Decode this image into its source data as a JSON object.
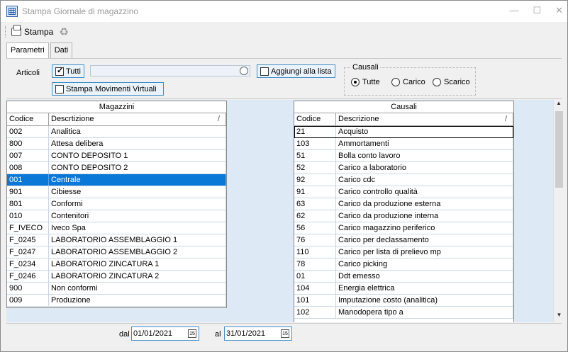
{
  "window": {
    "title": "Stampa Giornale di magazzino",
    "controls": [
      "—",
      "☐",
      "✕"
    ]
  },
  "toolbar": {
    "print_label": "Stampa"
  },
  "tabs": [
    {
      "label": "Parametri"
    },
    {
      "label": "Dati"
    }
  ],
  "filters": {
    "articoli_label": "Articoli",
    "tutti_label": "Tutti",
    "tutti_checked": true,
    "search_value": "",
    "aggiungi_label": "Aggiungi alla lista",
    "virtuali_label": "Stampa Movimenti Virtuali",
    "causali_title": "Causali",
    "causali_options": [
      "Tutte",
      "Carico",
      "Scarico"
    ],
    "causali_selected": "Tutte"
  },
  "magazzini": {
    "title": "Magazzini",
    "col_code": "Codice",
    "col_desc": "Descrtizione",
    "sort_mark": "/",
    "rows": [
      {
        "code": "002",
        "desc": "Analitica"
      },
      {
        "code": "800",
        "desc": "Attesa delibera"
      },
      {
        "code": "007",
        "desc": "CONTO DEPOSITO 1"
      },
      {
        "code": "008",
        "desc": "CONTO DEPOSITO 2"
      },
      {
        "code": "001",
        "desc": "Centrale"
      },
      {
        "code": "901",
        "desc": "Cibiesse"
      },
      {
        "code": "801",
        "desc": "Conformi"
      },
      {
        "code": "010",
        "desc": "Contenitori"
      },
      {
        "code": "F_IVECO",
        "desc": "Iveco Spa"
      },
      {
        "code": "F_0245",
        "desc": "LABORATORIO ASSEMBLAGGIO 1"
      },
      {
        "code": "F_0247",
        "desc": "LABORATORIO ASSEMBLAGGIO 2"
      },
      {
        "code": "F_0234",
        "desc": "LABORATORIO ZINCATURA 1"
      },
      {
        "code": "F_0246",
        "desc": "LABORATORIO ZINCATURA 2"
      },
      {
        "code": "900",
        "desc": "Non conformi"
      },
      {
        "code": "009",
        "desc": "Produzione"
      }
    ],
    "selected_index": 4
  },
  "causali": {
    "title": "Causali",
    "col_code": "Codice",
    "col_desc": "Descrizione",
    "sort_mark": "/",
    "rows": [
      {
        "code": "21",
        "desc": "Acquisto"
      },
      {
        "code": "103",
        "desc": "Ammortamenti"
      },
      {
        "code": "51",
        "desc": "Bolla conto lavoro"
      },
      {
        "code": "52",
        "desc": "Carico a laboratorio"
      },
      {
        "code": "92",
        "desc": "Carico cdc"
      },
      {
        "code": "91",
        "desc": "Carico controllo qualità"
      },
      {
        "code": "63",
        "desc": "Carico da produzione esterna"
      },
      {
        "code": "62",
        "desc": "Carico da produzione interna"
      },
      {
        "code": "56",
        "desc": "Carico magazzino periferico"
      },
      {
        "code": "76",
        "desc": "Carico per declassamento"
      },
      {
        "code": "110",
        "desc": "Carico per lista di prelievo mp"
      },
      {
        "code": "78",
        "desc": "Carico picking"
      },
      {
        "code": "01",
        "desc": "Ddt emesso"
      },
      {
        "code": "104",
        "desc": "Energia elettrica"
      },
      {
        "code": "101",
        "desc": "Imputazione costo (analitica)"
      },
      {
        "code": "102",
        "desc": "Manodopera tipo a"
      }
    ],
    "focused_index": 0
  },
  "dates": {
    "dal_label": "dal",
    "dal_value": "01/01/2021",
    "al_label": "al",
    "al_value": "31/01/2021",
    "calendar_glyph": "15"
  }
}
